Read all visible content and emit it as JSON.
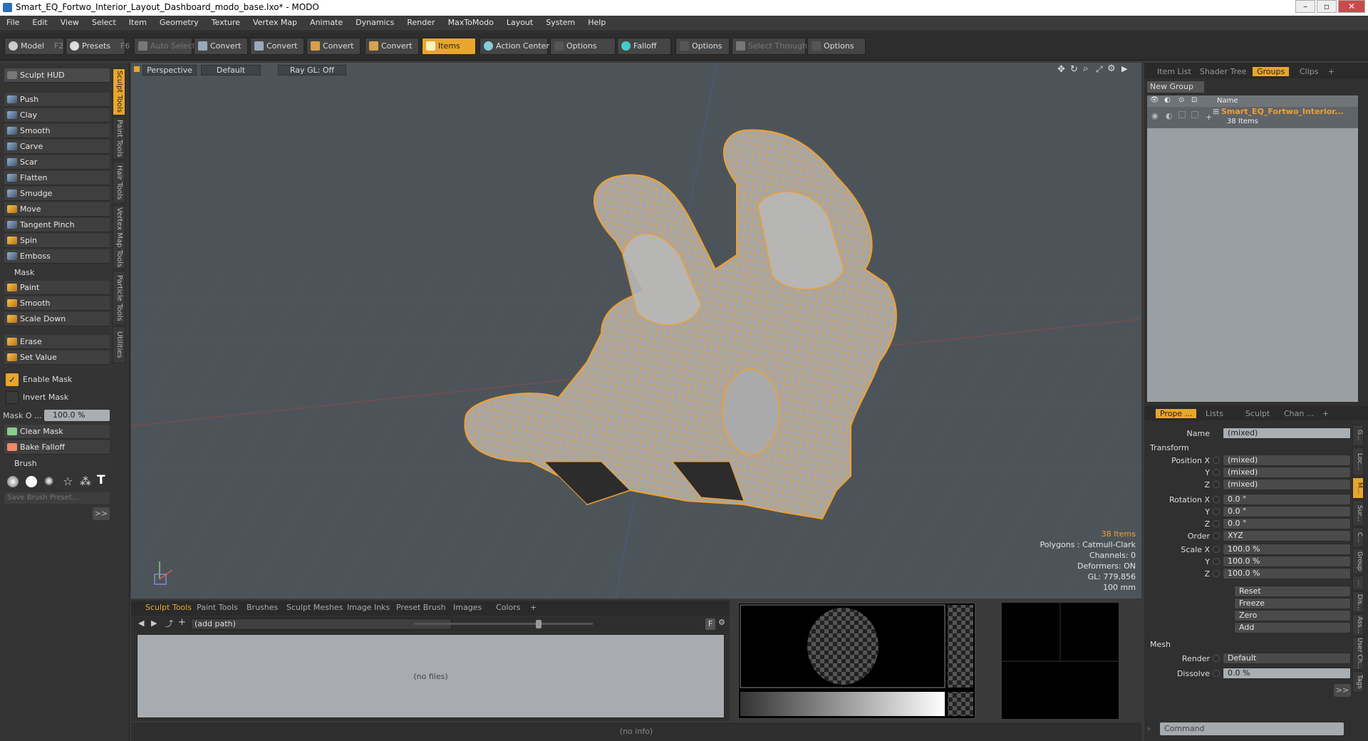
{
  "window": {
    "title": "Smart_EQ_Fortwo_Interior_Layout_Dashboard_modo_base.lxo* - MODO",
    "minimize": "–",
    "maximize": "▫",
    "close": "✕"
  },
  "menu": [
    "File",
    "Edit",
    "View",
    "Select",
    "Item",
    "Geometry",
    "Texture",
    "Vertex Map",
    "Animate",
    "Dynamics",
    "Render",
    "MaxToModo",
    "Layout",
    "System",
    "Help"
  ],
  "toolbar": {
    "model": "Model",
    "model_key": "F2",
    "presets": "Presets",
    "presets_key": "F6",
    "auto_select": "Auto Select",
    "convert1": "Convert",
    "convert2": "Convert",
    "convert3": "Convert",
    "convert4": "Convert",
    "items": "Items",
    "action_center": "Action Center",
    "options1": "Options",
    "falloff": "Falloff",
    "options2": "Options",
    "select_through": "Select Through",
    "options3": "Options"
  },
  "left": {
    "hud": "Sculpt HUD",
    "tools": [
      "Push",
      "Clay",
      "Smooth",
      "Carve",
      "Scar",
      "Flatten",
      "Smudge",
      "Move",
      "Tangent Pinch",
      "Spin",
      "Emboss"
    ],
    "mask_section": "Mask",
    "mask_tools": [
      "Paint",
      "Smooth",
      "Scale Down"
    ],
    "erase": "Erase",
    "set_value": "Set Value",
    "enable_mask": "Enable Mask",
    "invert_mask": "Invert Mask",
    "mask_opacity_label": "Mask O ...",
    "mask_opacity_value": "100.0 %",
    "clear_mask": "Clear Mask",
    "bake_falloff": "Bake Falloff",
    "brush_section": "Brush",
    "save_brush": "Save Brush Preset...",
    "more": ">>",
    "vtabs": [
      "Sculpt Tools",
      "Paint Tools",
      "Hair Tools",
      "Vertex Map Tools",
      "Particle Tools",
      "Utilities"
    ]
  },
  "viewport": {
    "view": "Perspective",
    "shading": "Default",
    "raygl": "Ray GL: Off",
    "hud": {
      "items": "38 Items",
      "polygons": "Polygons : Catmull-Clark",
      "channels": "Channels: 0",
      "deformers": "Deformers: ON",
      "gl": "GL: 779,856",
      "scale": "100 mm"
    }
  },
  "bottom": {
    "tabs": [
      "Sculpt Tools",
      "Paint Tools",
      "Brushes",
      "Sculpt Meshes",
      "Image Inks",
      "Preset Brush",
      "Images",
      "Colors",
      "+"
    ],
    "path": "(add path)",
    "nofiles": "(no files)",
    "status": "(no info)",
    "f_button": "F"
  },
  "right": {
    "tabs_top": [
      "Item List",
      "Shader Tree",
      "Groups",
      "Clips",
      "+"
    ],
    "new_group": "New Group",
    "col_name": "Name",
    "group_name": "Smart_EQ_Fortwo_Interior...",
    "group_count": "38 Items",
    "tabs_props": [
      "Prope ...",
      "Lists",
      "Sculpt",
      "Chan ...",
      "+"
    ],
    "name_label": "Name",
    "name_value": "(mixed)",
    "transform": "Transform",
    "position_x_label": "Position X",
    "y_label": "Y",
    "z_label": "Z",
    "mixed": "(mixed)",
    "rotation_x_label": "Rotation X",
    "rot_value": "0.0 °",
    "order_label": "Order",
    "order_value": "XYZ",
    "scale_x_label": "Scale X",
    "scale_value": "100.0 %",
    "reset": "Reset",
    "freeze": "Freeze",
    "zero": "Zero",
    "add": "Add",
    "mesh": "Mesh",
    "render_label": "Render",
    "render_value": "Default",
    "dissolve_label": "Dissolve",
    "dissolve_value": "0.0 %",
    "more": ">>",
    "command": "Command",
    "side_tabs": [
      "G...",
      "Loc...",
      "M...",
      "Sur...",
      "C...",
      "Group",
      "...",
      "Dis...",
      "Ass...",
      "User Ch...",
      "Tags"
    ]
  },
  "colors": {
    "accent": "#e8a62c",
    "wire": "#f0a030",
    "viewport": "#4d5459"
  }
}
